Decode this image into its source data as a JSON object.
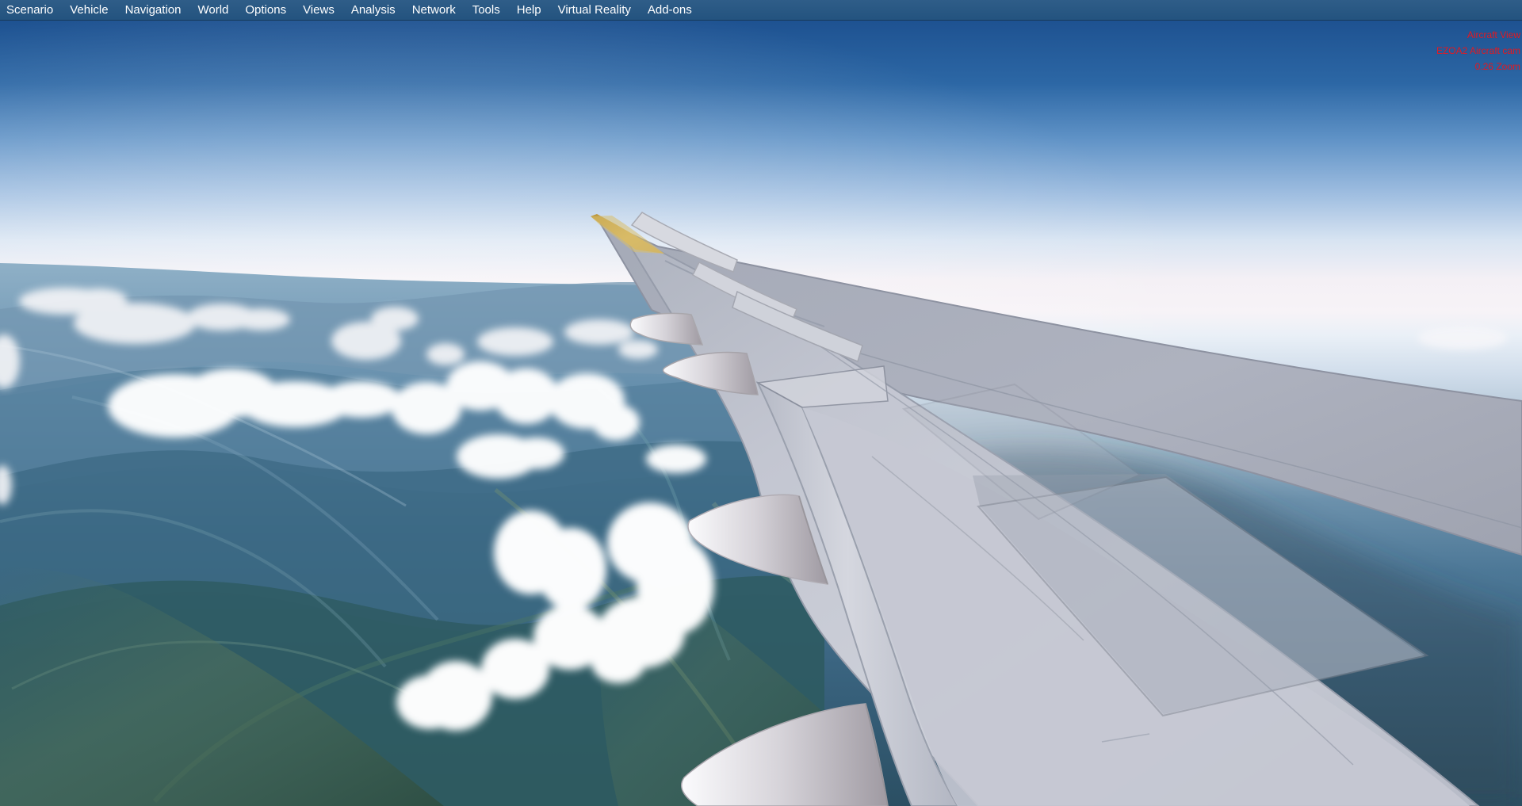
{
  "menu": {
    "items": [
      "Scenario",
      "Vehicle",
      "Navigation",
      "World",
      "Options",
      "Views",
      "Analysis",
      "Network",
      "Tools",
      "Help",
      "Virtual Reality",
      "Add-ons"
    ]
  },
  "camera_readout": {
    "view": "Aircraft View",
    "camera": "EZOA2 Aircraft cam",
    "zoom": "0.26 Zoom"
  },
  "colors": {
    "menu_bar": "#23537f",
    "readout_text": "#e11d28",
    "wing_surface": "#c9ccd5",
    "wingtip": "#d3b15c"
  }
}
